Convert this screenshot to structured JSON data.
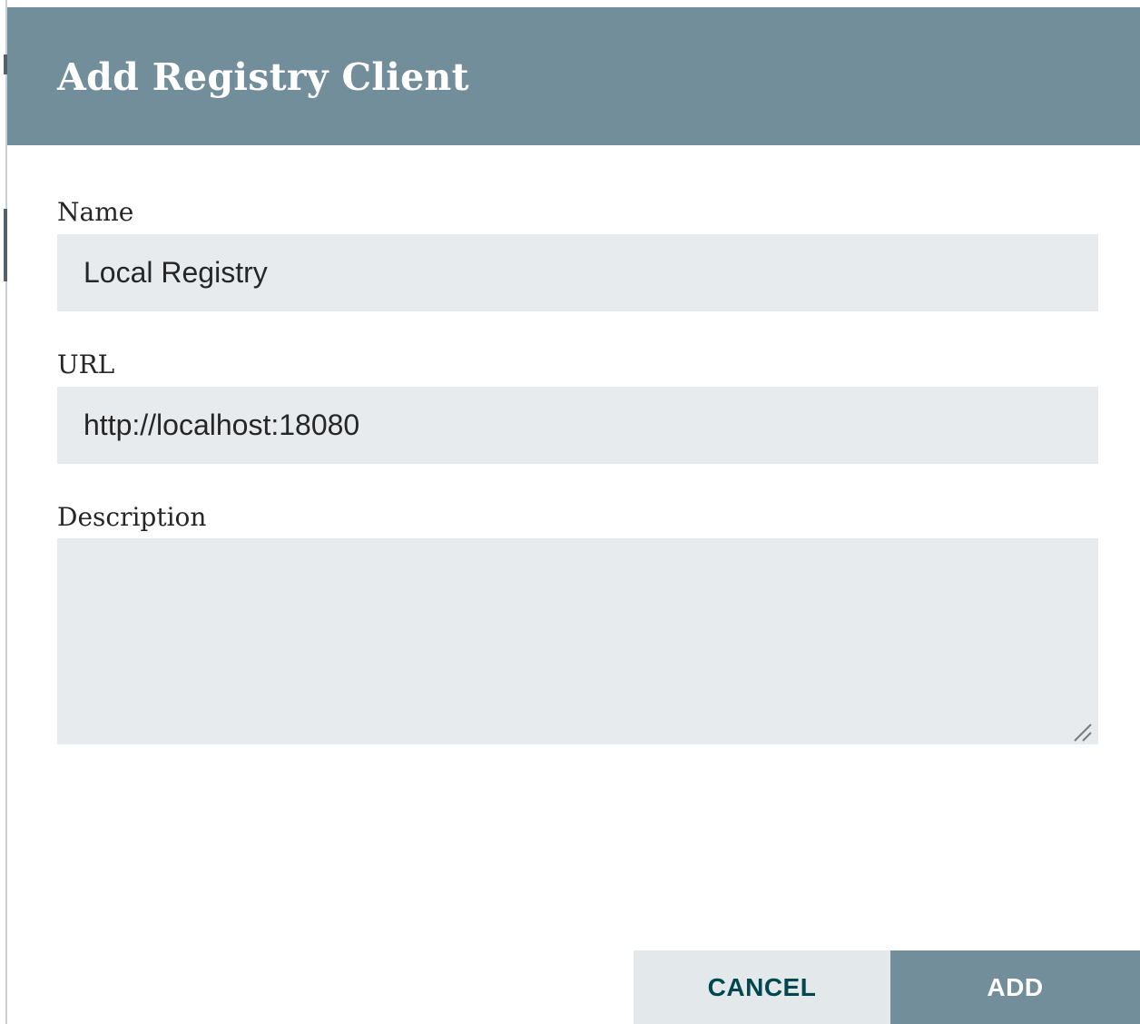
{
  "dialog": {
    "title": "Add Registry Client",
    "header_color": "#728e9b",
    "fields": {
      "name": {
        "label": "Name",
        "value": "Local Registry"
      },
      "url": {
        "label": "URL",
        "value": "http://localhost:18080"
      },
      "description": {
        "label": "Description",
        "value": ""
      }
    },
    "buttons": {
      "cancel_label": "CANCEL",
      "add_label": "ADD"
    }
  },
  "icons": {
    "textarea_resize": "resize-grip-icon"
  }
}
